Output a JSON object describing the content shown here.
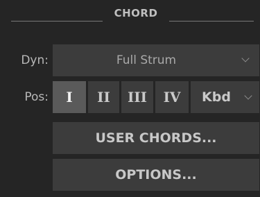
{
  "section": {
    "title": "CHORD"
  },
  "dyn": {
    "label": "Dyn:",
    "value": "Full Strum",
    "icon": "chevron-down-icon"
  },
  "pos": {
    "label": "Pos:",
    "buttons": [
      {
        "label": "I",
        "active": true
      },
      {
        "label": "II",
        "active": false
      },
      {
        "label": "III",
        "active": false
      },
      {
        "label": "IV",
        "active": false
      }
    ],
    "kbd_label": "Kbd",
    "kbd_icon": "chevron-down-icon"
  },
  "buttons": {
    "user_chords": "USER CHORDS...",
    "options": "OPTIONS..."
  },
  "colors": {
    "background": "#252525",
    "control": "#3c3c3c",
    "active": "#5a5a5a",
    "text": "#c8c8c8"
  }
}
